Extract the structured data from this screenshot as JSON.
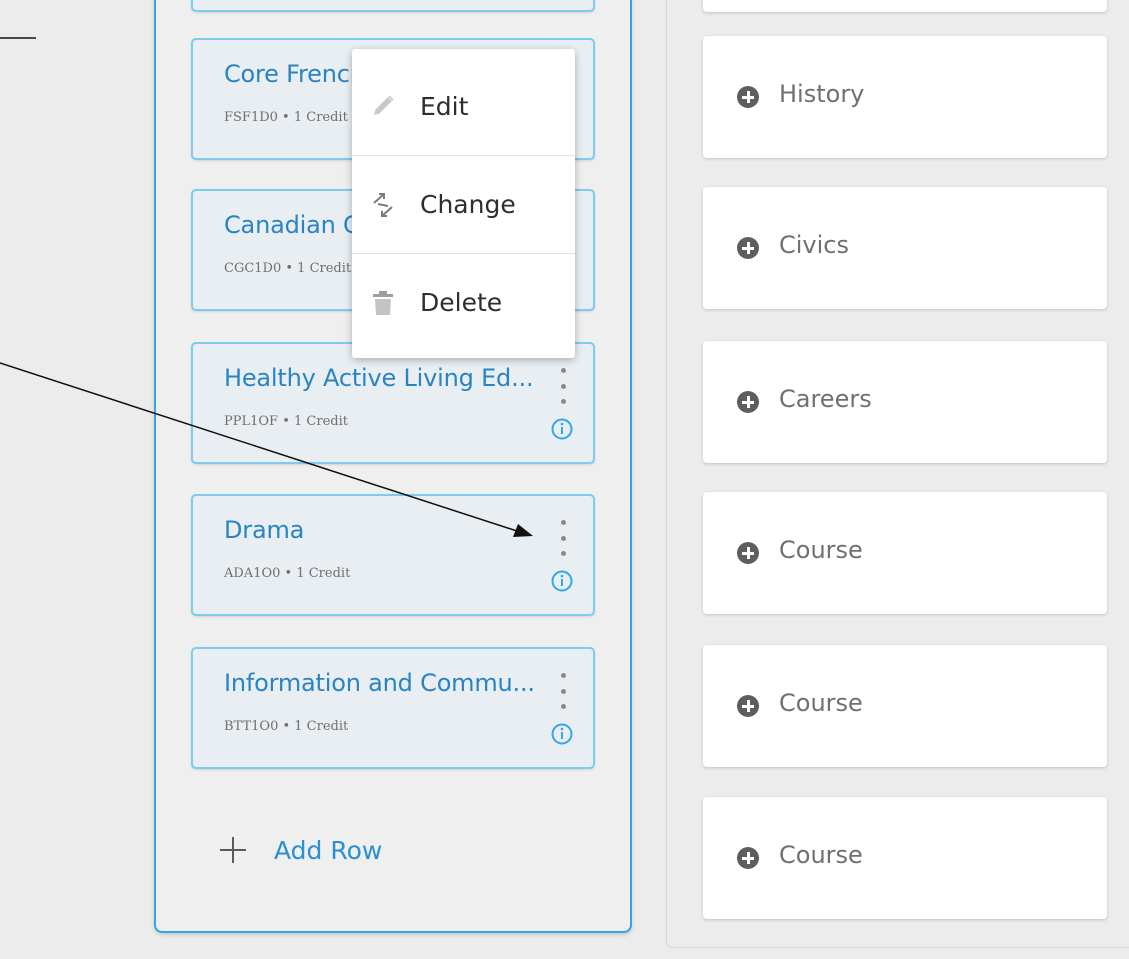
{
  "planner": {
    "courses": [
      {
        "title": "Core French",
        "code_line": "FSF1D0 • 1 Credit"
      },
      {
        "title": "Canadian Geography",
        "code_line": "CGC1D0 • 1 Credit"
      },
      {
        "title": "Healthy Active Living Ed...",
        "code_line": "PPL1OF • 1 Credit"
      },
      {
        "title": "Drama",
        "code_line": "ADA1O0 • 1 Credit"
      },
      {
        "title": "Information and Commu...",
        "code_line": "BTT1O0 • 1 Credit"
      }
    ],
    "add_row_label": "Add Row"
  },
  "context_menu": {
    "items": [
      {
        "label": "Edit",
        "icon": "pencil-icon"
      },
      {
        "label": "Change",
        "icon": "swap-arrows-icon"
      },
      {
        "label": "Delete",
        "icon": "trash-icon"
      }
    ]
  },
  "slots": [
    {
      "label": "History"
    },
    {
      "label": "Civics"
    },
    {
      "label": "Careers"
    },
    {
      "label": "Course"
    },
    {
      "label": "Course"
    },
    {
      "label": "Course"
    }
  ],
  "colors": {
    "accent_blue": "#2ea8e6",
    "course_title": "#2a84c2",
    "card_bg": "#e9eef3"
  }
}
